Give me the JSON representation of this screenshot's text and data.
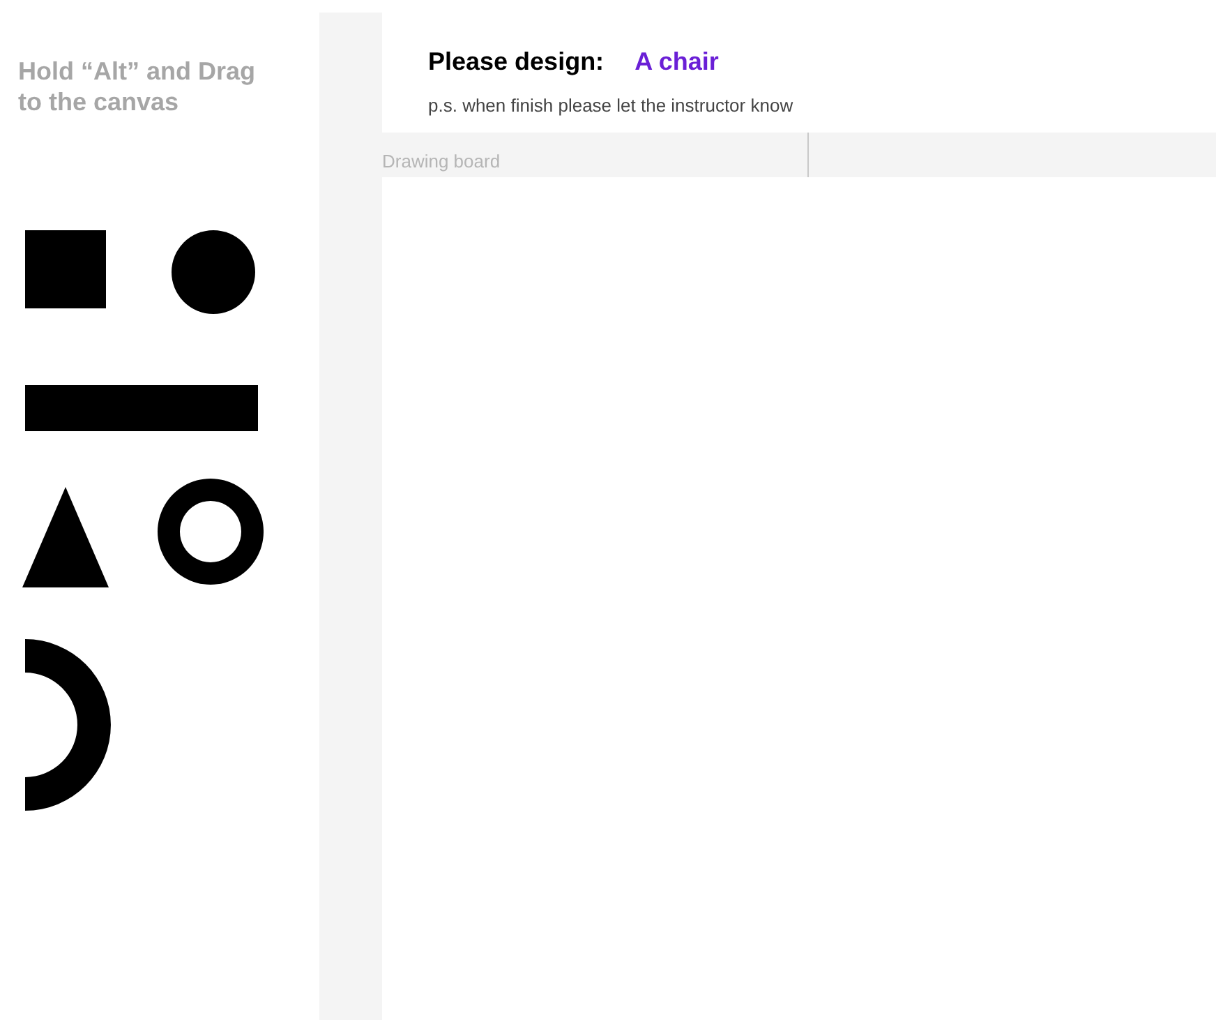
{
  "palette": {
    "instruction": "Hold “Alt” and Drag to the canvas",
    "shapes": [
      {
        "kind": "square"
      },
      {
        "kind": "circle"
      },
      {
        "kind": "bar"
      },
      {
        "kind": "triangle"
      },
      {
        "kind": "ring"
      },
      {
        "kind": "half-ring"
      }
    ]
  },
  "task": {
    "prompt": "Please design:",
    "subject": "A chair",
    "note": "p.s. when finish please let the instructor know"
  },
  "board": {
    "label": "Drawing board"
  }
}
